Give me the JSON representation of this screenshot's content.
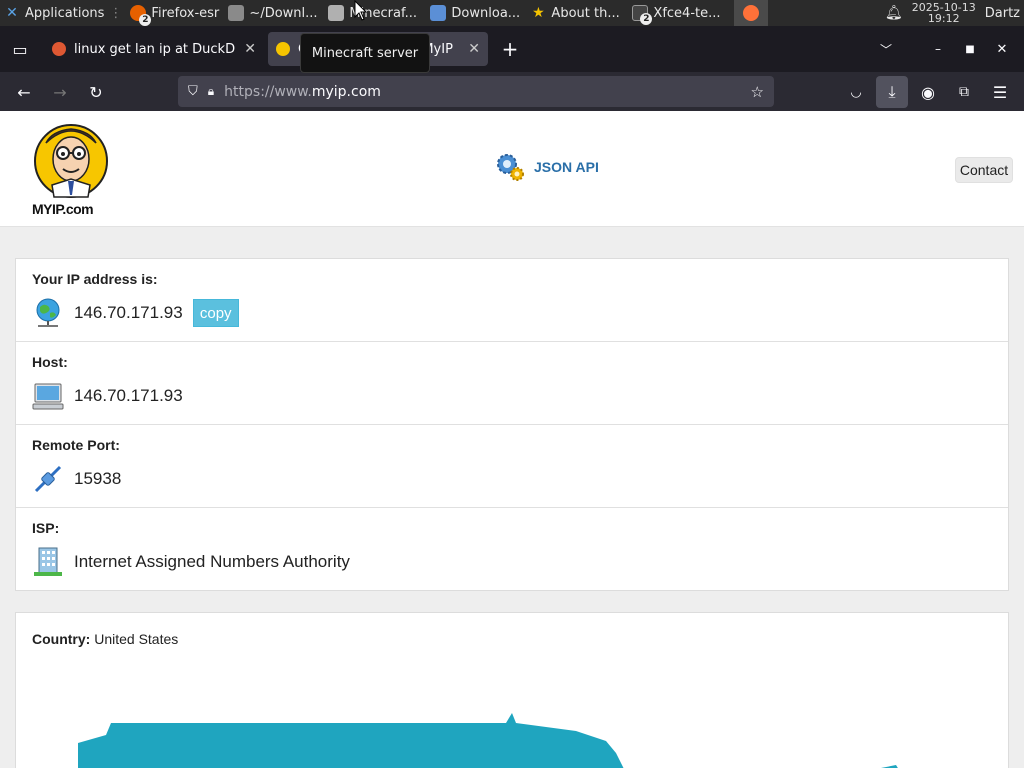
{
  "panel": {
    "apps_label": "Applications",
    "tasks": [
      {
        "label": "Firefox-esr",
        "badge": "2"
      },
      {
        "label": "~/Downl..."
      },
      {
        "label": "Minecraf..."
      },
      {
        "label": "Downloa..."
      },
      {
        "label": "About th..."
      },
      {
        "label": "Xfce4-te...",
        "badge": "2"
      }
    ],
    "clock_date": "2025-10-13",
    "clock_time": "19:12",
    "user": "Dartz"
  },
  "browser": {
    "tabs": [
      {
        "title": "linux get lan ip at DuckDuckGo"
      },
      {
        "title": "Check IP Address | MyIP"
      }
    ],
    "tooltip": "Minecraft server",
    "url_scheme": "https://www.",
    "url_host": "myip.com"
  },
  "site": {
    "logo_text": "MYIP.com",
    "json_api_label": "JSON API",
    "contact_label": "Contact",
    "rows": [
      {
        "label": "Your IP address is:",
        "value": "146.70.171.93",
        "icon": "globe-network-icon"
      },
      {
        "label": "Host:",
        "value": "146.70.171.93",
        "icon": "computer-icon"
      },
      {
        "label": "Remote Port:",
        "value": "15938",
        "icon": "plug-icon"
      },
      {
        "label": "ISP:",
        "value": "Internet Assigned Numbers Authority",
        "icon": "building-icon"
      }
    ],
    "copy_label": "copy",
    "country_label": "Country:",
    "country_value": "United States"
  },
  "colors": {
    "panel_bg": "#2b2b2b",
    "tabstrip_bg": "#1c1b22",
    "navbar_bg": "#2b2a33",
    "urlbar_bg": "#42414d",
    "link_blue": "#2a6fa8",
    "copy_button": "#5bc0de",
    "map_fill": "#1fa5bf"
  }
}
